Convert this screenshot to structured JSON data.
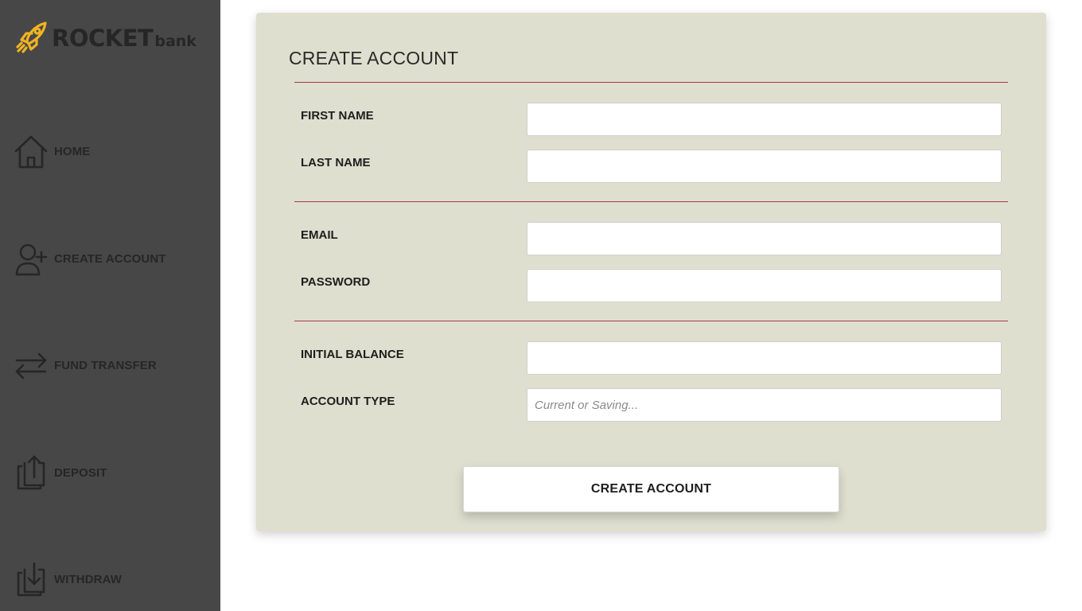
{
  "brand": {
    "name_main": "ROCKET",
    "name_sub": "bank",
    "logo_icon": "rocket-icon",
    "logo_color": "#f0b323"
  },
  "sidebar": {
    "items": [
      {
        "label": "HOME",
        "icon": "home-icon"
      },
      {
        "label": "CREATE ACCOUNT",
        "icon": "user-plus-icon"
      },
      {
        "label": "FUND TRANSFER",
        "icon": "transfer-arrows-icon"
      },
      {
        "label": "DEPOSIT",
        "icon": "upload-icon"
      },
      {
        "label": "WITHDRAW",
        "icon": "download-icon"
      }
    ]
  },
  "form": {
    "title": "CREATE ACCOUNT",
    "fields": [
      {
        "label": "FIRST NAME",
        "value": "",
        "placeholder": ""
      },
      {
        "label": "LAST NAME",
        "value": "",
        "placeholder": ""
      },
      {
        "label": "EMAIL",
        "value": "",
        "placeholder": ""
      },
      {
        "label": "PASSWORD",
        "value": "",
        "placeholder": ""
      },
      {
        "label": "INITIAL BALANCE",
        "value": "",
        "placeholder": ""
      },
      {
        "label": "ACCOUNT TYPE",
        "value": "",
        "placeholder": "Current or Saving..."
      }
    ],
    "submit_label": "CREATE ACCOUNT"
  },
  "colors": {
    "sidebar_bg": "#474747",
    "card_bg": "#dfdfcf",
    "divider": "#a43a44",
    "text_dark": "#262626"
  }
}
